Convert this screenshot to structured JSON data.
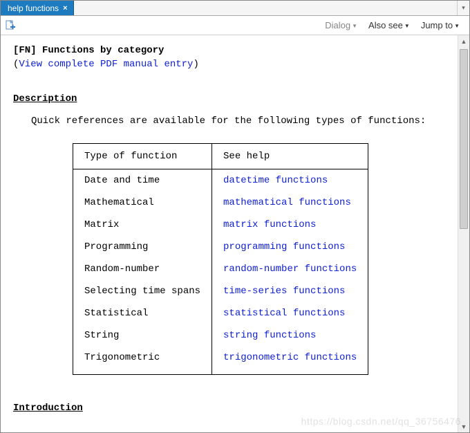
{
  "tab": {
    "title": "help functions"
  },
  "toolbar": {
    "dialog": "Dialog",
    "also_see": "Also see",
    "jump_to": "Jump to"
  },
  "doc": {
    "fn_tag": "[FN]",
    "title": "Functions by category",
    "pdf_open": "(",
    "pdf_link": "View complete PDF manual entry",
    "pdf_close": ")",
    "section_description": "Description",
    "quick_ref": "Quick references are available for the following types of functions:",
    "col_type": "Type of function",
    "col_help": "See help",
    "rows": [
      {
        "type": "Date and time",
        "help": "datetime functions"
      },
      {
        "type": "Mathematical",
        "help": "mathematical functions"
      },
      {
        "type": "Matrix",
        "help": "matrix functions"
      },
      {
        "type": "Programming",
        "help": "programming functions"
      },
      {
        "type": "Random-number",
        "help": "random-number functions"
      },
      {
        "type": "Selecting time spans",
        "help": "time-series functions"
      },
      {
        "type": "Statistical",
        "help": "statistical functions"
      },
      {
        "type": "String",
        "help": "string functions"
      },
      {
        "type": "Trigonometric",
        "help": "trigonometric functions"
      }
    ],
    "section_introduction": "Introduction"
  },
  "watermark": "https://blog.csdn.net/qq_36756476"
}
